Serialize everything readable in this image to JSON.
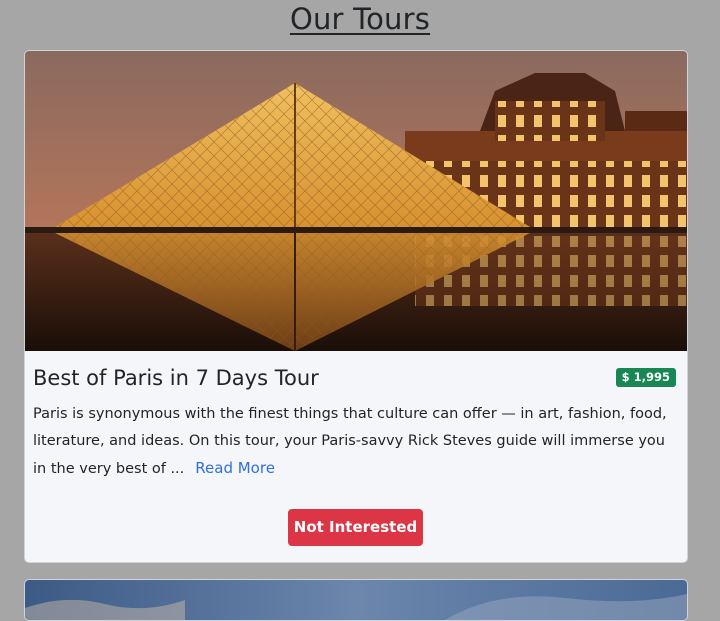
{
  "page": {
    "title": "Our Tours"
  },
  "tours": [
    {
      "name": "Best of Paris in 7 Days Tour",
      "price": "$ 1,995",
      "info": "Paris is synonymous with the finest things that culture can offer — in art, fashion, food, literature, and ideas. On this tour, your Paris-savvy Rick Steves guide will immerse you in the very best of ...",
      "read_more_label": "Read More",
      "not_interested_label": "Not Interested"
    }
  ],
  "colors": {
    "page_background": "#a6a6a6",
    "card_background": "#f4f6f9",
    "price_badge": "#198754",
    "not_interested_button": "#dc3545",
    "link": "#2f6fe0"
  }
}
